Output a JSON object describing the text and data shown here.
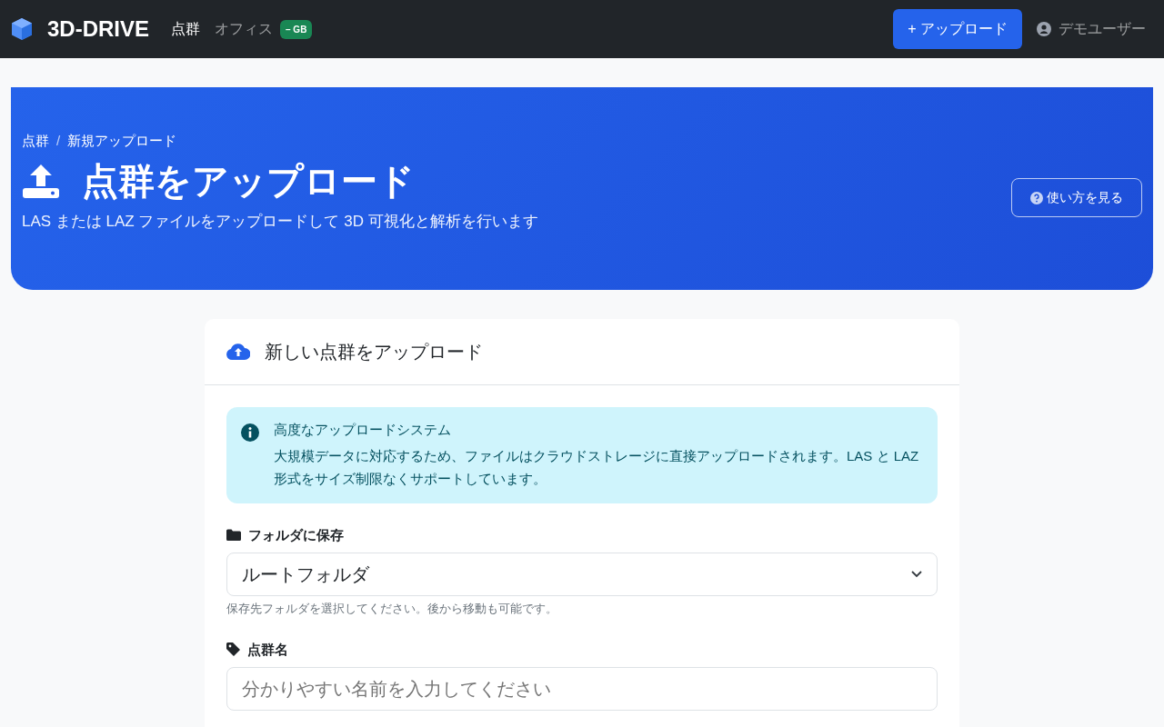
{
  "navbar": {
    "brand": "3D-DRIVE",
    "nav_items": [
      {
        "label": "点群",
        "selected": true
      },
      {
        "label": "オフィス",
        "selected": false,
        "badge": "– GB"
      }
    ],
    "upload_button": "+ アップロード",
    "user": "デモユーザー"
  },
  "hero": {
    "breadcrumb": [
      {
        "label": "点群"
      },
      {
        "label": "新規アップロード"
      }
    ],
    "breadcrumb_separator": "/",
    "title": "点群をアップロード",
    "subtitle": "LAS または LAZ ファイルをアップロードして 3D 可視化と解析を行います",
    "help_button": "使い方を見る"
  },
  "card": {
    "title": "新しい点群をアップロード",
    "alert": {
      "heading": "高度なアップロードシステム",
      "text": "大規模データに対応するため、ファイルはクラウドストレージに直接アップロードされます。LAS と LAZ 形式をサイズ制限なくサポートしています。"
    },
    "fields": [
      {
        "kind": "select",
        "label": "フォルダに保存",
        "value": "ルートフォルダ",
        "help": "保存先フォルダを選択してください。後から移動も可能です。"
      },
      {
        "kind": "text",
        "label": "点群名",
        "placeholder": "分かりやすい名前を入力してください"
      }
    ]
  }
}
